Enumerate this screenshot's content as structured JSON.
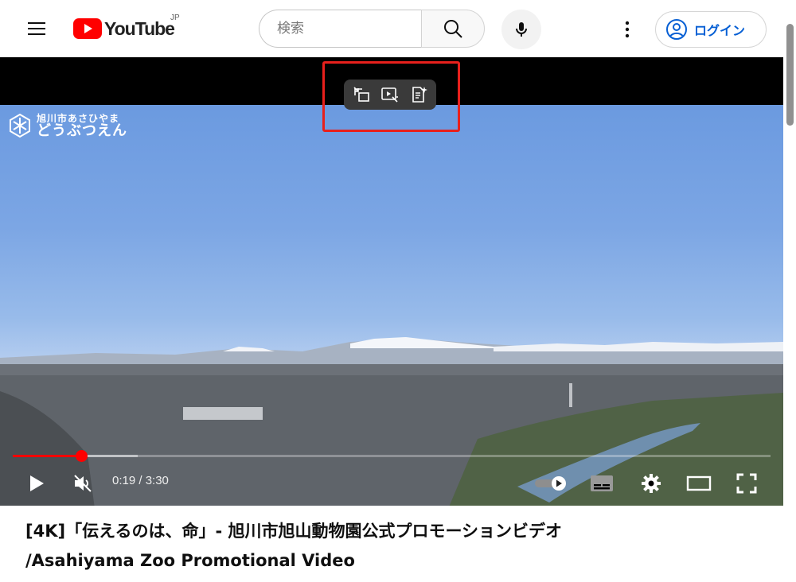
{
  "header": {
    "logo_text": "YouTube",
    "country_code": "JP",
    "search_placeholder": "検索",
    "login_label": "ログイン"
  },
  "colors": {
    "brand_red": "#ff0000",
    "link_blue": "#065fd4",
    "highlight": "#e8201c"
  },
  "player": {
    "zoo_logo_line1": "旭川市あさひやま",
    "zoo_logo_line2": "どうぶつえん",
    "time_display": "0:19 / 3:30",
    "progress_fraction": 0.09,
    "loaded_fraction": 0.165,
    "muted": true,
    "overlay_tools": [
      "swap-screen-icon",
      "video-ai-icon",
      "summary-ai-icon"
    ]
  },
  "video": {
    "title_line1": "[4K]「伝えるのは、命」- 旭川市旭山動物園公式プロモーションビデオ",
    "title_line2": "/Asahiyama Zoo Promotional Video"
  }
}
